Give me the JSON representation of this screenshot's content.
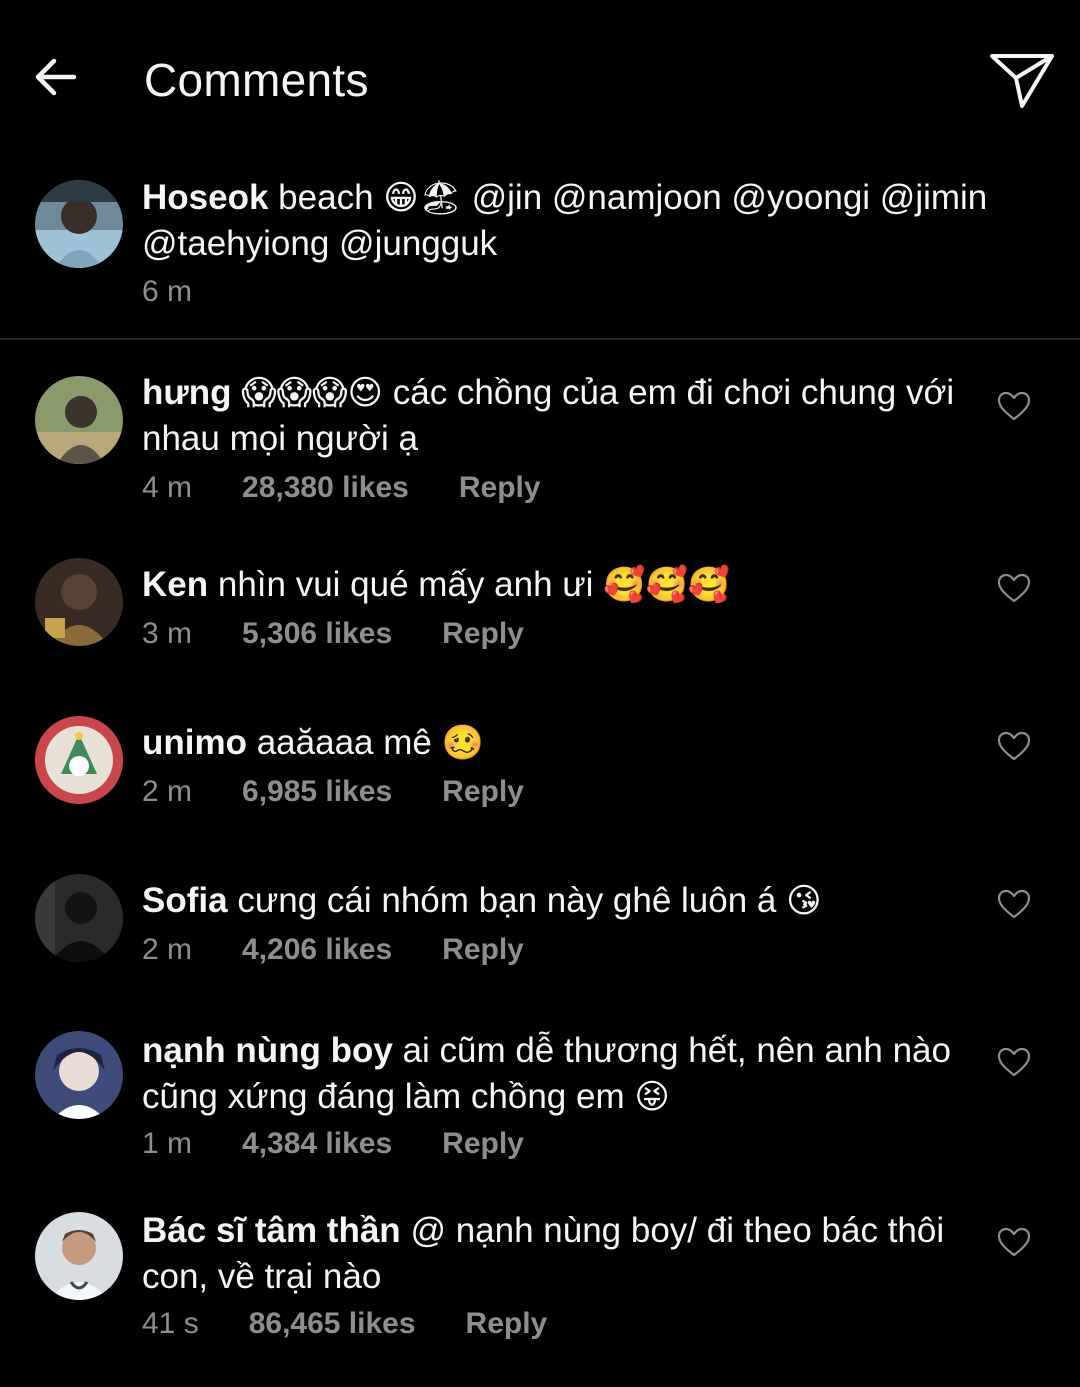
{
  "header": {
    "title": "Comments",
    "back_icon": "arrow-left-icon",
    "share_icon": "paper-plane-icon"
  },
  "caption": {
    "username": "Hoseok",
    "text_before_emoji": "beach",
    "emoji": "😁🏖",
    "text_after_emoji": "@jin @namjoon @yoongi @jimin @taehyiong @jungguk",
    "time": "6 m"
  },
  "comments": [
    {
      "username": "hưng",
      "emoji_lead": "😱😱😱😍",
      "text": "các chồng của em đi chơi chung với nhau mọi người ạ",
      "emoji_trail": "",
      "time": "4 m",
      "likes": "28,380 likes",
      "reply": "Reply"
    },
    {
      "username": "Ken",
      "emoji_lead": "",
      "text": "nhìn vui qué mấy anh ưi",
      "emoji_trail": "🥰🥰🥰",
      "time": "3 m",
      "likes": "5,306 likes",
      "reply": "Reply"
    },
    {
      "username": "unimo",
      "emoji_lead": "",
      "text": "aaăaaa mê",
      "emoji_trail": "🥴",
      "time": "2 m",
      "likes": "6,985 likes",
      "reply": "Reply"
    },
    {
      "username": "Sofia",
      "emoji_lead": "",
      "text": "cưng cái nhóm bạn này ghê luôn á",
      "emoji_trail": "😘",
      "time": "2 m",
      "likes": "4,206 likes",
      "reply": "Reply"
    },
    {
      "username": "nạnh nùng boy",
      "emoji_lead": "",
      "text": "ai cũm dễ thương hết, nên anh nào cũng xứng đáng làm chồng em",
      "emoji_trail": "😝",
      "time": "1 m",
      "likes": "4,384 likes",
      "reply": "Reply"
    },
    {
      "username": "Bác sĩ tâm thần",
      "emoji_lead": "",
      "text": "@ nạnh nùng boy/ đi theo bác thôi con, về trại nào",
      "emoji_trail": "",
      "time": "41 s",
      "likes": "86,465 likes",
      "reply": "Reply"
    }
  ],
  "icons": {
    "like": "heart-outline-icon"
  },
  "colors": {
    "background": "#000000",
    "text_primary": "#f5f5f5",
    "text_secondary": "#8e8e8e",
    "divider": "#262626"
  }
}
